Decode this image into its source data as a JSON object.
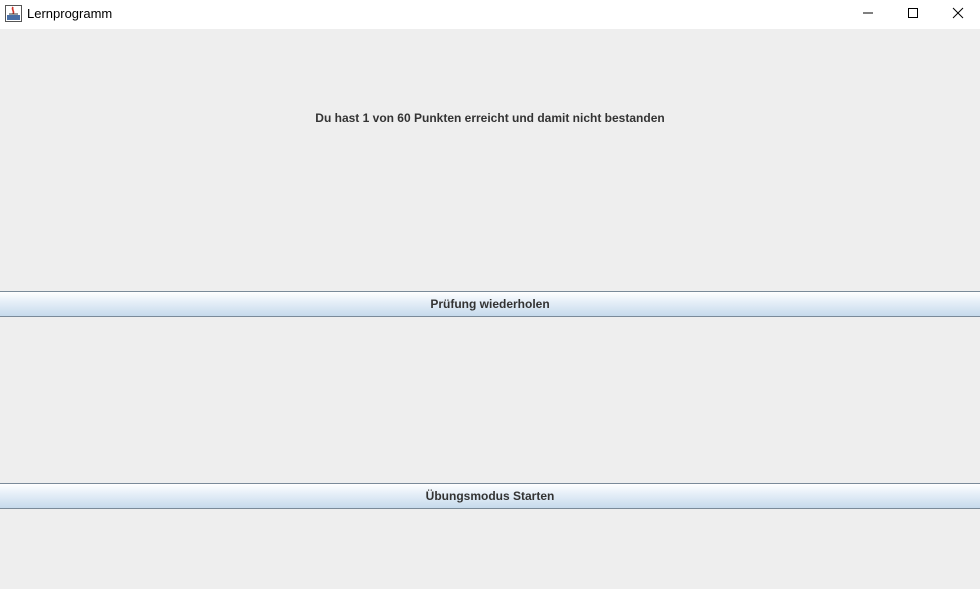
{
  "window": {
    "title": "Lernprogramm",
    "icon": "java-app-icon",
    "controls": {
      "minimize": "minimize-icon",
      "maximize": "maximize-icon",
      "close": "close-icon"
    }
  },
  "main": {
    "result_message": "Du hast 1 von 60 Punkten erreicht und damit nicht bestanden",
    "retry_button_label": "Prüfung wiederholen",
    "practice_button_label": "Übungsmodus Starten"
  },
  "colors": {
    "background": "#eeeeee",
    "titlebar": "#ffffff",
    "button_border": "#7a8a99",
    "text": "#333333"
  }
}
